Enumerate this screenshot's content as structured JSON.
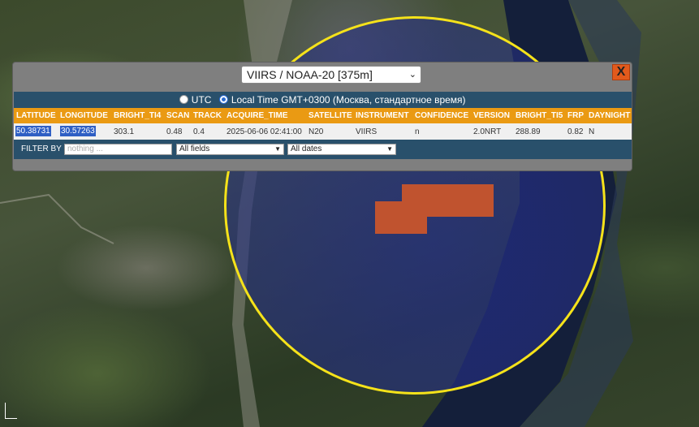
{
  "popup": {
    "sensor_select": "VIIRS / NOAA-20 [375m]",
    "close_label": "X",
    "timezone": {
      "utc_label": "UTC",
      "local_label": "Local Time GMT+0300 (Москва, стандартное время)",
      "selected": "local"
    },
    "columns": [
      "LATITUDE",
      "LONGITUDE",
      "BRIGHT_TI4",
      "SCAN",
      "TRACK",
      "ACQUIRE_TIME",
      "SATELLITE",
      "INSTRUMENT",
      "CONFIDENCE",
      "VERSION",
      "BRIGHT_TI5",
      "FRP",
      "DAYNIGHT"
    ],
    "row": [
      "50.38731",
      "30.57263",
      "303.1",
      "0.48",
      "0.4",
      "2025-06-06 02:41:00",
      "N20",
      "VIIRS",
      "n",
      "2.0NRT",
      "288.89",
      "0.82",
      "N"
    ],
    "filter": {
      "label": "FILTER BY",
      "placeholder": "nothing ...",
      "field_select": "All fields",
      "date_select": "All dates"
    }
  },
  "colors": {
    "header_bg": "#ea9a13",
    "bar_bg": "#29506b",
    "close_bg": "#e25a1c",
    "circle_border": "#f5e21a",
    "fire_pixel": "#c0532f"
  }
}
